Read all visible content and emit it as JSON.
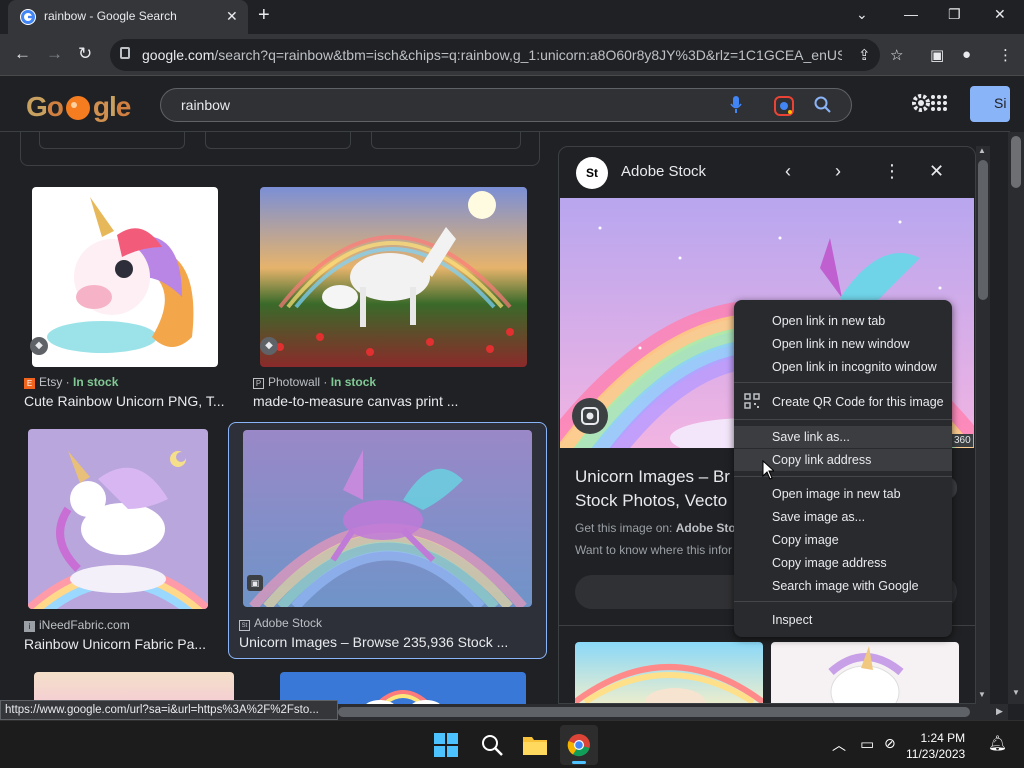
{
  "browser": {
    "tab_title": "rainbow - Google Search",
    "tab_close": "✕",
    "new_tab": "+",
    "url_domain": "google.com",
    "url_rest": "/search?q=rainbow&tbm=isch&chips=q:rainbow,g_1:unicorn:a8O60r8y8JY%3D&rlz=1C1GCEA_enUS..."
  },
  "google": {
    "logo_letters": [
      "G",
      "o",
      "g",
      "l",
      "e"
    ],
    "query": "rainbow",
    "signin_label": "Si"
  },
  "results": [
    {
      "source": "Etsy",
      "stock": "In stock",
      "source_icon": "E",
      "title": "Cute Rainbow Unicorn PNG, T..."
    },
    {
      "source": "Photowall",
      "stock": "In stock",
      "source_icon": "P",
      "title": "made-to-measure canvas print ..."
    },
    {
      "source": "iNeedFabric.com",
      "stock": "",
      "source_icon": "i",
      "title": "Rainbow Unicorn Fabric Pa..."
    },
    {
      "source": "Adobe Stock",
      "stock": "",
      "source_icon": "St",
      "title": "Unicorn Images – Browse 235,936 Stock ..."
    }
  ],
  "panel": {
    "logo_text": "St",
    "source_name": "Adobe Stock",
    "title_line1": "Unicorn Images – Br",
    "title_line2": "Stock Photos, Vecto",
    "get_image_prefix": "Get this image on: ",
    "get_image_source": "Adobe Stock",
    "want_to_know": "Want to know where this infor",
    "img_size_fragment": "360"
  },
  "context_menu": {
    "items": [
      "Open link in new tab",
      "Open link in new window",
      "Open link in incognito window",
      "Create QR Code for this image",
      "Save link as...",
      "Copy link address",
      "Open image in new tab",
      "Save image as...",
      "Copy image",
      "Copy image address",
      "Search image with Google",
      "Inspect"
    ]
  },
  "status_url": "https://www.google.com/url?sa=i&url=https%3A%2F%2Fsto...",
  "taskbar": {
    "time": "1:24 PM",
    "date": "11/23/2023"
  },
  "colors": {
    "accent": "#8ab4f8",
    "in_stock": "#81c995",
    "logo_orange": "#f57c1f"
  }
}
